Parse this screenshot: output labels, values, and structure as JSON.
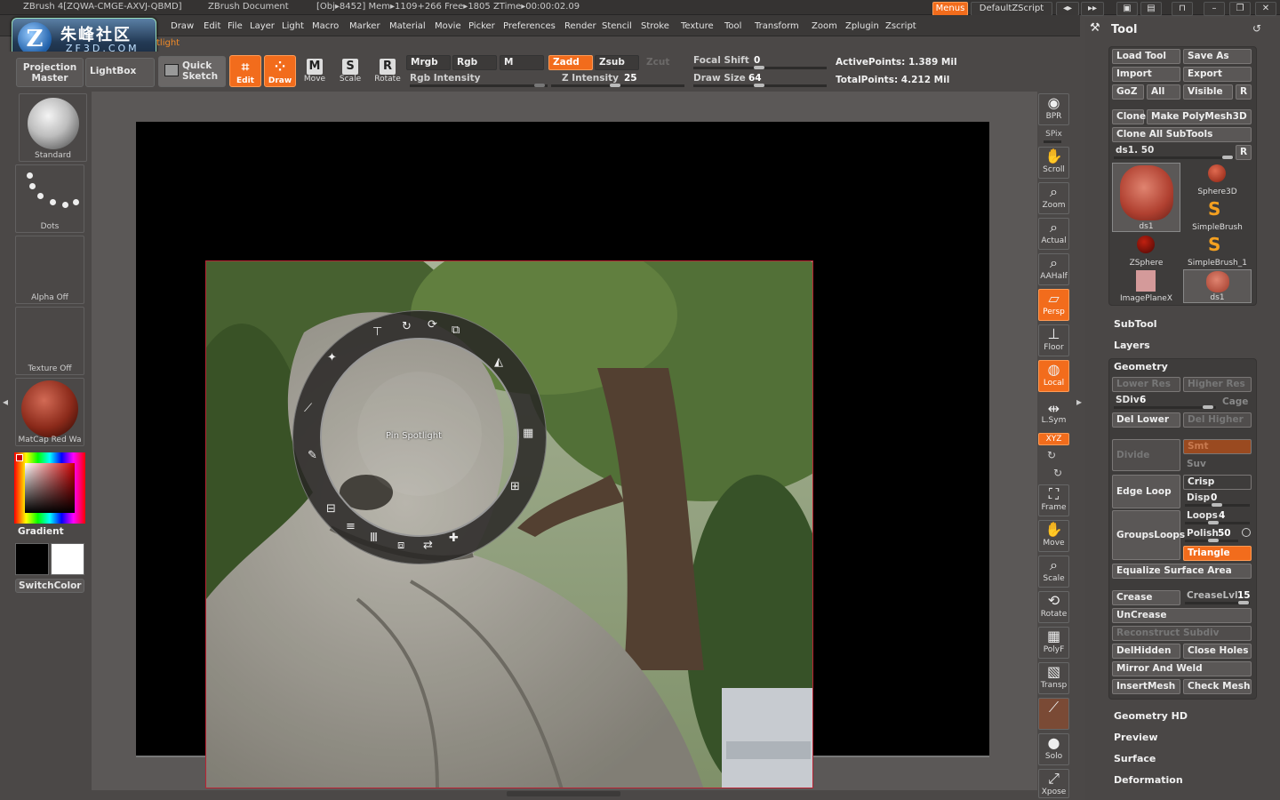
{
  "titlebar": {
    "app_title": "ZBrush 4[ZQWA-CMGE-AXVJ-QBMD]",
    "doc_title": "ZBrush Document",
    "stats": "[Obj▸8452] Mem▸1109+266 Free▸1805 ZTime▸00:00:02.09",
    "menus_label": "Menus",
    "script_label": "DefaultZScript"
  },
  "logo": {
    "cn": "朱峰社区",
    "en": "ZF3D.COM"
  },
  "spotlight_fragment": "tlight",
  "menubar": [
    "Draw",
    "Edit",
    "File",
    "Layer",
    "Light",
    "Macro",
    "Marker",
    "Material",
    "Movie",
    "Picker",
    "Preferences",
    "Render",
    "Stencil",
    "Stroke",
    "Texture",
    "Tool",
    "Transform",
    "Zoom",
    "Zplugin",
    "Zscript"
  ],
  "toolbar": {
    "projection_master": "Projection Master",
    "lightbox": "LightBox",
    "quick_sketch": "Quick Sketch",
    "edit": "Edit",
    "draw": "Draw",
    "move": "Move",
    "scale": "Scale",
    "rotate": "Rotate",
    "move_key": "M",
    "scale_key": "S",
    "rotate_key": "R",
    "mrgb": "Mrgb",
    "rgb": "Rgb",
    "m": "M",
    "zadd": "Zadd",
    "zsub": "Zsub",
    "zcut": "Zcut",
    "rgb_intensity": "Rgb Intensity",
    "z_intensity_label": "Z Intensity",
    "z_intensity": "25",
    "focal_shift_label": "Focal Shift",
    "focal_shift": "0",
    "draw_size_label": "Draw Size",
    "draw_size": "64",
    "active_points": "ActivePoints: 1.389 Mil",
    "total_points": "TotalPoints: 4.212 Mil"
  },
  "left_shelf": {
    "brush": "Standard",
    "stroke": "Dots",
    "alpha": "Alpha Off",
    "texture": "Texture Off",
    "material": "MatCap Red Wa",
    "gradient": "Gradient",
    "switch_color": "SwitchColor"
  },
  "spotlight": {
    "label": "Pin Spotlight"
  },
  "right_shelf": [
    "BPR",
    "SPix",
    "Scroll",
    "Zoom",
    "Actual",
    "AAHalf",
    "Persp",
    "Floor",
    "Local",
    "L.Sym",
    "XYZ",
    "Frame",
    "Move",
    "Scale",
    "Rotate",
    "PolyF",
    "Transp",
    "Solo",
    "Xpose"
  ],
  "tool_palette": {
    "title": "Tool",
    "load_tool": "Load Tool",
    "save_as": "Save As",
    "import": "Import",
    "export": "Export",
    "goz": "GoZ",
    "all": "All",
    "visible": "Visible",
    "r": "R",
    "clone": "Clone",
    "make_polymesh": "Make PolyMesh3D",
    "clone_all": "Clone All SubTools",
    "current_tool": "ds1. 50",
    "thumbs": [
      "ds1",
      "Sphere3D",
      "SimpleBrush",
      "ZSphere",
      "SimpleBrush_1",
      "ImagePlaneX",
      "ds1"
    ],
    "subtool": "SubTool",
    "layers": "Layers",
    "geometry": "Geometry",
    "lower_res": "Lower Res",
    "higher_res": "Higher Res",
    "sdiv_label": "SDiv",
    "sdiv": "6",
    "cage": "Cage",
    "del_lower": "Del Lower",
    "del_higher": "Del Higher",
    "divide": "Divide",
    "smt": "Smt",
    "suv": "Suv",
    "edge_loop": "Edge Loop",
    "crisp": "Crisp",
    "disp_label": "Disp",
    "disp": "0",
    "groups_loops": "GroupsLoops",
    "loops_label": "Loops",
    "loops": "4",
    "polish_label": "Polish",
    "polish": "50",
    "triangle": "Triangle",
    "equalize": "Equalize Surface Area",
    "crease": "Crease",
    "crease_lvl_label": "CreaseLvl",
    "crease_lvl": "15",
    "uncrease": "UnCrease",
    "reconstruct": "Reconstruct Subdiv",
    "del_hidden": "DelHidden",
    "close_holes": "Close Holes",
    "mirror_weld": "Mirror And Weld",
    "insert_mesh": "InsertMesh",
    "check_mesh": "Check Mesh",
    "geometry_hd": "Geometry HD",
    "preview": "Preview",
    "surface": "Surface",
    "deformation": "Deformation"
  }
}
